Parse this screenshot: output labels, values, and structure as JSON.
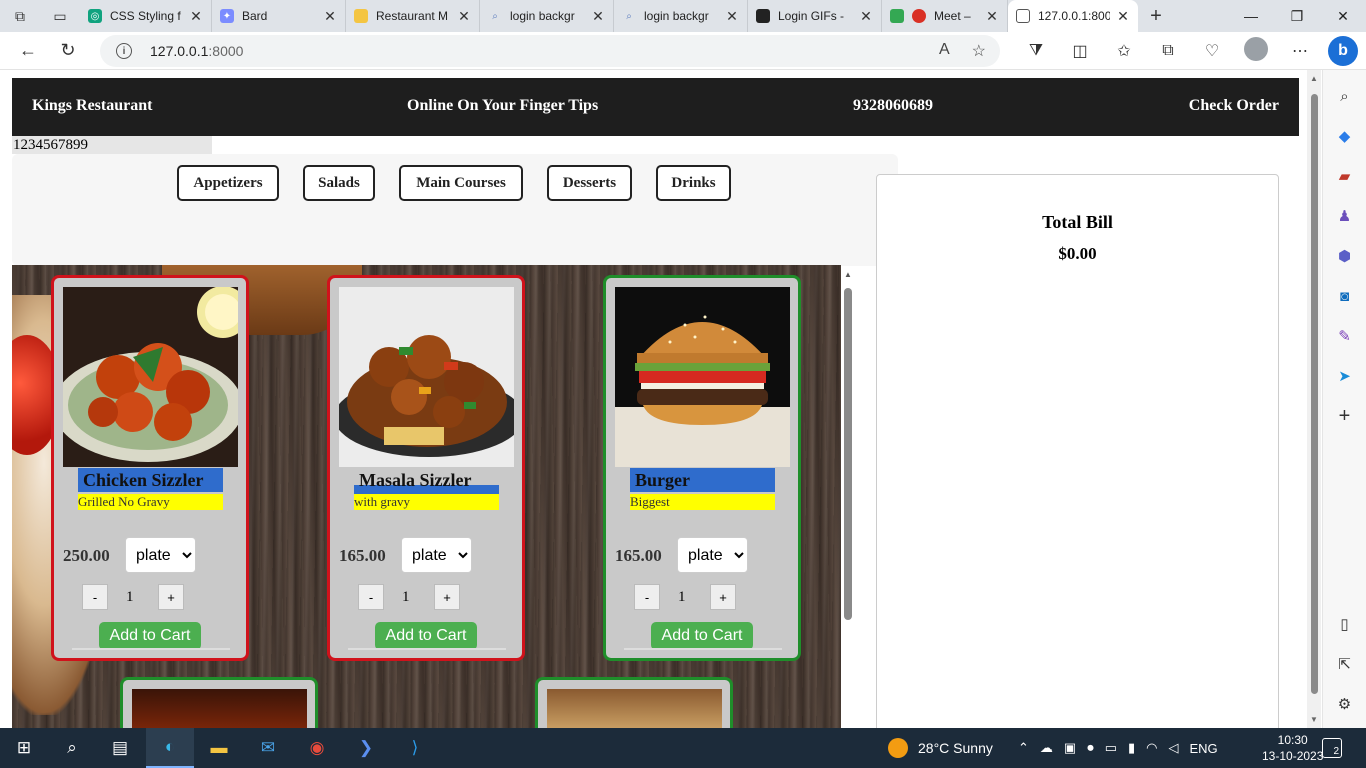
{
  "browser": {
    "tabs": [
      {
        "title": "CSS Styling f",
        "color": "#10a37f"
      },
      {
        "title": "Bard",
        "color": "#7b8cff"
      },
      {
        "title": "Restaurant M",
        "color": "#f4c542"
      },
      {
        "title": "login backgr",
        "color": "#5f7fbf"
      },
      {
        "title": "login backgr",
        "color": "#5f7fbf"
      },
      {
        "title": "Login GIFs -",
        "color": "#222222"
      },
      {
        "title": "Meet –",
        "color": "#d93025"
      },
      {
        "title": "127.0.0.1:800",
        "color": "#555555"
      }
    ],
    "url_host": "127.0.0.1",
    "url_port": ":8000"
  },
  "header": {
    "brand": "Kings Restaurant",
    "tagline": "Online On Your Finger Tips",
    "phone": "9328060689",
    "check_order": "Check Order"
  },
  "number_field": "1234567899",
  "categories": [
    "Appetizers",
    "Salads",
    "Main Courses",
    "Desserts",
    "Drinks"
  ],
  "bill": {
    "title": "Total Bill",
    "amount": "$0.00"
  },
  "menu": [
    {
      "name": "Chicken Sizzler",
      "desc": "Grilled No Gravy",
      "price": "250.00",
      "unit": "plate",
      "qty": "1",
      "add_label": "Add to Cart",
      "border": "#d0121b"
    },
    {
      "name": "Masala Sizzler",
      "desc": "with gravy",
      "price": "165.00",
      "unit": "plate",
      "qty": "1",
      "add_label": "Add to Cart",
      "border": "#d0121b"
    },
    {
      "name": "Burger",
      "desc": "Biggest",
      "price": "165.00",
      "unit": "plate",
      "qty": "1",
      "add_label": "Add to Cart",
      "border": "#1f8e2a"
    }
  ],
  "qty_controls": {
    "minus": "-",
    "plus": "+"
  },
  "taskbar": {
    "weather": "28°C  Sunny",
    "lang": "ENG",
    "time": "10:30",
    "date": "13-10-2023",
    "notifications": "2"
  }
}
